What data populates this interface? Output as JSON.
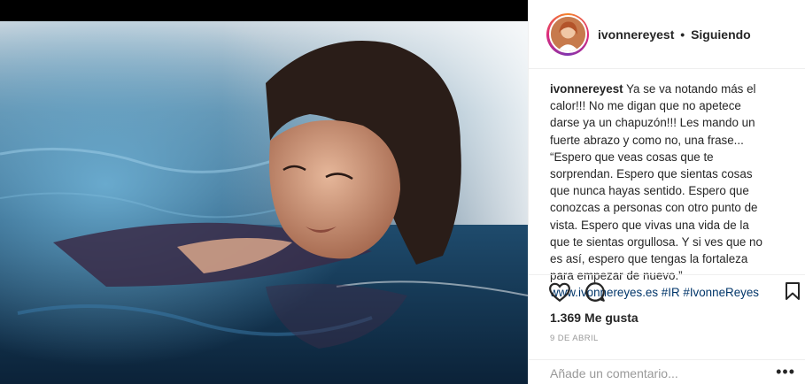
{
  "post": {
    "username": "ivonnereyest",
    "separator": "•",
    "follow_status": "Siguiendo",
    "caption_user": "ivonnereyest",
    "caption_text": "Ya se va notando más el calor!!! No me digan que no apetece darse ya un chapuzón!!! Les mando un fuerte abrazo y como no, una frase... “Espero que veas cosas que te sorprendan. Espero que sientas cosas que nunca hayas sentido. Espero que conozcas a personas con otro punto de vista. Espero que vivas una vida de la que te sientas orgullosa. Y si ves que no es así, espero que tengas la fortaleza para empezar de nuevo.”",
    "caption_link": "www.ivonnereyes.es",
    "hashtags": [
      "#IR",
      "#IvonneReyes"
    ],
    "likes_count": "1.369",
    "likes_label": "Me gusta",
    "date": "9 DE ABRIL"
  },
  "comment": {
    "placeholder": "Añade un comentario...",
    "more_label": "•••"
  },
  "icons": {
    "like": "heart-icon",
    "comment": "comment-icon",
    "save": "bookmark-icon",
    "more": "more-options-icon"
  },
  "colors": {
    "text": "#262626",
    "link": "#003569",
    "muted": "#999999",
    "border": "#efefef"
  }
}
